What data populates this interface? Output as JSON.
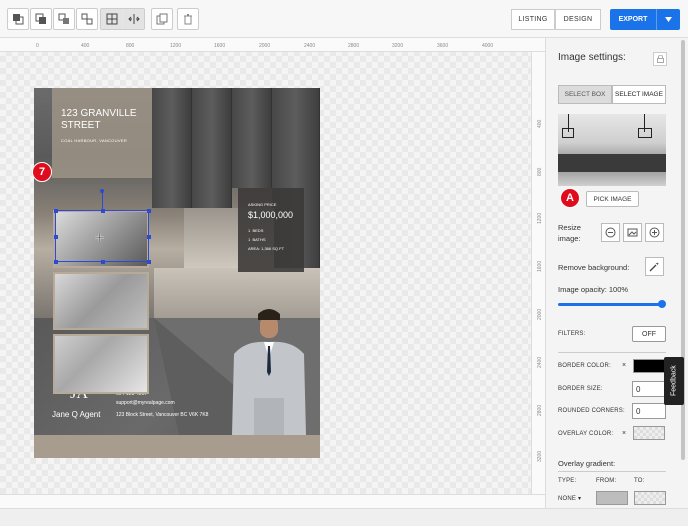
{
  "toolbar": {
    "mode_buttons": [
      "LISTING",
      "DESIGN"
    ],
    "export_label": "EXPORT",
    "icons": [
      "bring-forward-icon",
      "send-backward-icon",
      "group-icon",
      "ungroup-icon",
      "grid-icon",
      "align-icon",
      "duplicate-icon",
      "trash-icon"
    ]
  },
  "ruler": {
    "top_ticks": [
      "0",
      "400",
      "800",
      "1200",
      "1600",
      "2000",
      "2400",
      "2800",
      "3200",
      "3600",
      "4000",
      "4400",
      "4800"
    ],
    "side_ticks": [
      "400",
      "800",
      "1200",
      "1600",
      "2000",
      "2400",
      "2800",
      "3200",
      "3600"
    ]
  },
  "flyer": {
    "address_line1": "123 GRANVILLE",
    "address_line2": "STREET",
    "location": "COAL HARBOUR, VANCOUVER",
    "asking_label": "ASKING PRICE",
    "price": "$1,000,000",
    "beds": "BEDS",
    "baths": "BATHS",
    "area": "AREA: 1,366 SQ FT",
    "beds_count": "1",
    "baths_count": "1",
    "agent_name": "Jane Q Agent",
    "phone": "604-123-4567",
    "email": "support@myrealpage.com",
    "address": "123 Block Street, Vancouver BC V6K 7K8",
    "logo_letters": "JA"
  },
  "badges": {
    "canvas": "7",
    "panel": "A"
  },
  "panel": {
    "title": "Image settings:",
    "select_box": "SELECT BOX",
    "select_image": "SELECT IMAGE",
    "pick_image": "PICK IMAGE",
    "resize_label_1": "Resize",
    "resize_label_2": "image:",
    "remove_bg": "Remove background:",
    "opacity_label": "Image opacity: 100%",
    "opacity_value": 1.0,
    "filters": "FILTERS:",
    "filters_btn": "OFF",
    "border_color": "BORDER COLOR:",
    "border_size": "BORDER SIZE:",
    "border_size_val": "0",
    "rounded": "ROUNDED CORNERS:",
    "rounded_val": "0",
    "overlay_color": "OVERLAY COLOR:",
    "overlay_gradient": "Overlay gradient:",
    "type": "TYPE:",
    "from": "FROM:",
    "to": "TO:",
    "type_val": "NONE",
    "x": "×"
  },
  "feedback": "Feedback",
  "colors": {
    "accent": "#1a73e8",
    "badge": "#e00b1c",
    "selection": "#2d4ad0"
  }
}
